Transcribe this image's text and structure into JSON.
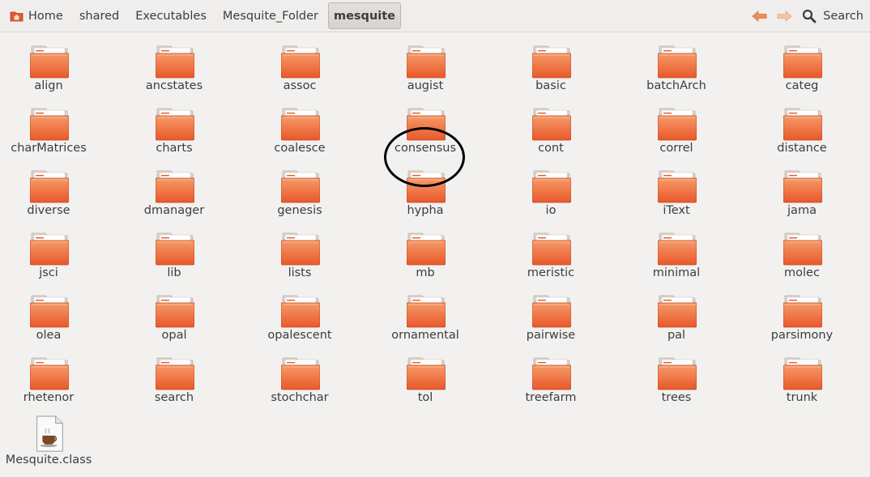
{
  "breadcrumb": [
    "Home",
    "shared",
    "Executables",
    "Mesquite_Folder",
    "mesquite"
  ],
  "toolbar": {
    "back_icon": "back-arrow-icon",
    "forward_icon": "forward-arrow-icon",
    "search_label": "Search"
  },
  "folders": [
    "align",
    "ancstates",
    "assoc",
    "augist",
    "basic",
    "batchArch",
    "categ",
    "charMatrices",
    "charts",
    "coalesce",
    "consensus",
    "cont",
    "correl",
    "distance",
    "diverse",
    "dmanager",
    "genesis",
    "hypha",
    "io",
    "iText",
    "jama",
    "jsci",
    "lib",
    "lists",
    "mb",
    "meristic",
    "minimal",
    "molec",
    "olea",
    "opal",
    "opalescent",
    "ornamental",
    "pairwise",
    "pal",
    "parsimony",
    "rhetenor",
    "search",
    "stochchar",
    "tol",
    "treefarm",
    "trees",
    "trunk"
  ],
  "files": [
    {
      "name": "Mesquite.class",
      "icon": "java-class-file-icon"
    }
  ],
  "colors": {
    "folder_top": "#f69a68",
    "folder_bottom": "#e8582b",
    "background": "#f2f1f0",
    "nav_arrow": "#f08e5a"
  }
}
